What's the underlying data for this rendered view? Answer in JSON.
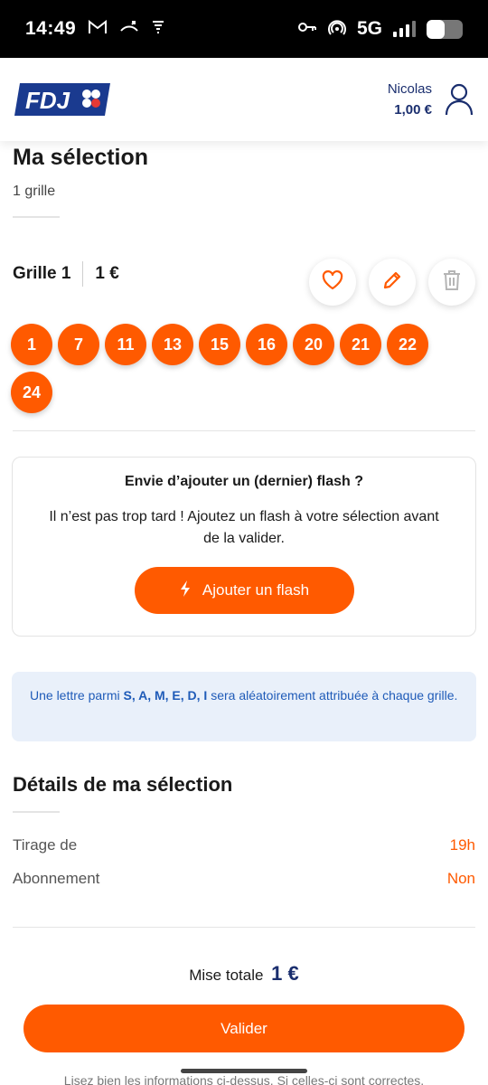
{
  "status_bar": {
    "time": "14:49",
    "network": "5G",
    "battery_level": 0.5
  },
  "header": {
    "logo_text": "FDJ",
    "user_name": "Nicolas",
    "balance": "1,00 €"
  },
  "selection": {
    "title": "Ma sélection",
    "subtitle": "1 grille",
    "grille_label": "Grille 1",
    "grille_price": "1 €",
    "numbers": [
      "1",
      "7",
      "11",
      "13",
      "15",
      "16",
      "20",
      "21",
      "22",
      "24"
    ]
  },
  "flash_card": {
    "title": "Envie d’ajouter un (dernier) flash ?",
    "text": "Il n’est pas trop tard ! Ajoutez un flash à votre sélection avant de la valider.",
    "button_label": "Ajouter un flash"
  },
  "info": {
    "prefix": "Une lettre parmi ",
    "letters": "S, A, M, E, D, I",
    "suffix": " sera aléatoirement attribuée à chaque grille."
  },
  "details": {
    "title": "Détails de ma sélection",
    "rows": [
      {
        "label": "Tirage de",
        "value": "19h"
      },
      {
        "label": "Abonnement",
        "value": "Non"
      }
    ]
  },
  "summary": {
    "mise_label": "Mise totale",
    "mise_amount": "1 €",
    "validate_label": "Valider",
    "footer_text": "Lisez bien les informations ci-dessus. Si celles-ci sont correctes,"
  },
  "colors": {
    "accent": "#ff5a00",
    "brand_blue": "#1a2e6e",
    "info_bg": "#e9f0fa",
    "info_text": "#1f5bb8"
  }
}
